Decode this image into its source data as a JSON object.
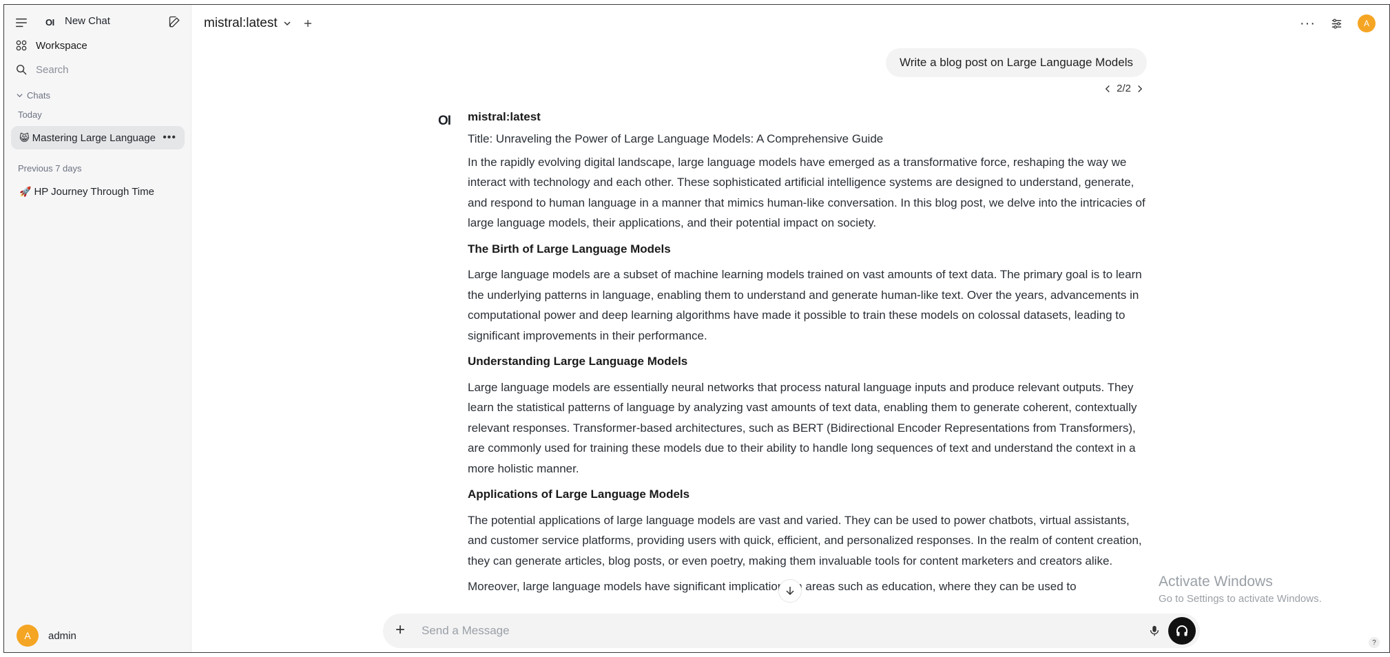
{
  "sidebar": {
    "logo": "OI",
    "new_chat": "New Chat",
    "workspace": "Workspace",
    "search_placeholder": "Search",
    "chats_header": "Chats",
    "groups": [
      {
        "label": "Today",
        "items": [
          {
            "emoji": "😸",
            "title": "Mastering Large Language Models"
          }
        ]
      },
      {
        "label": "Previous 7 days",
        "items": [
          {
            "emoji": "🚀",
            "title": "HP Journey Through Time"
          }
        ]
      }
    ],
    "more": "•••",
    "user": {
      "initial": "A",
      "name": "admin"
    }
  },
  "header": {
    "model": "mistral:latest",
    "more": "···",
    "avatar_initial": "A"
  },
  "conversation": {
    "user_message": "Write a blog post on Large Language Models",
    "pager": "2/2",
    "assistant_logo": "OI",
    "assistant_name": "mistral:latest",
    "title_line": "Title: Unraveling the Power of Large Language Models: A Comprehensive Guide",
    "intro": "In the rapidly evolving digital landscape, large language models have emerged as a transformative force, reshaping the way we interact with technology and each other. These sophisticated artificial intelligence systems are designed to understand, generate, and respond to human language in a manner that mimics human-like conversation. In this blog post, we delve into the intricacies of large language models, their applications, and their potential impact on society.",
    "h1": "The Birth of Large Language Models",
    "p1": "Large language models are a subset of machine learning models trained on vast amounts of text data. The primary goal is to learn the underlying patterns in language, enabling them to understand and generate human-like text. Over the years, advancements in computational power and deep learning algorithms have made it possible to train these models on colossal datasets, leading to significant improvements in their performance.",
    "h2": "Understanding Large Language Models",
    "p2": "Large language models are essentially neural networks that process natural language inputs and produce relevant outputs. They learn the statistical patterns of language by analyzing vast amounts of text data, enabling them to generate coherent, contextually relevant responses. Transformer-based architectures, such as BERT (Bidirectional Encoder Representations from Transformers), are commonly used for training these models due to their ability to handle long sequences of text and understand the context in a more holistic manner.",
    "h3": "Applications of Large Language Models",
    "p3": "The potential applications of large language models are vast and varied. They can be used to power chatbots, virtual assistants, and customer service platforms, providing users with quick, efficient, and personalized responses. In the realm of content creation, they can generate articles, blog posts, or even poetry, making them invaluable tools for content marketers and creators alike.",
    "p4": "Moreover, large language models have significant implications in areas such as education, where they can be used to"
  },
  "composer": {
    "placeholder": "Send a Message",
    "plus": "+"
  },
  "watermark": {
    "line1": "Activate Windows",
    "line2": "Go to Settings to activate Windows."
  },
  "help": "?"
}
